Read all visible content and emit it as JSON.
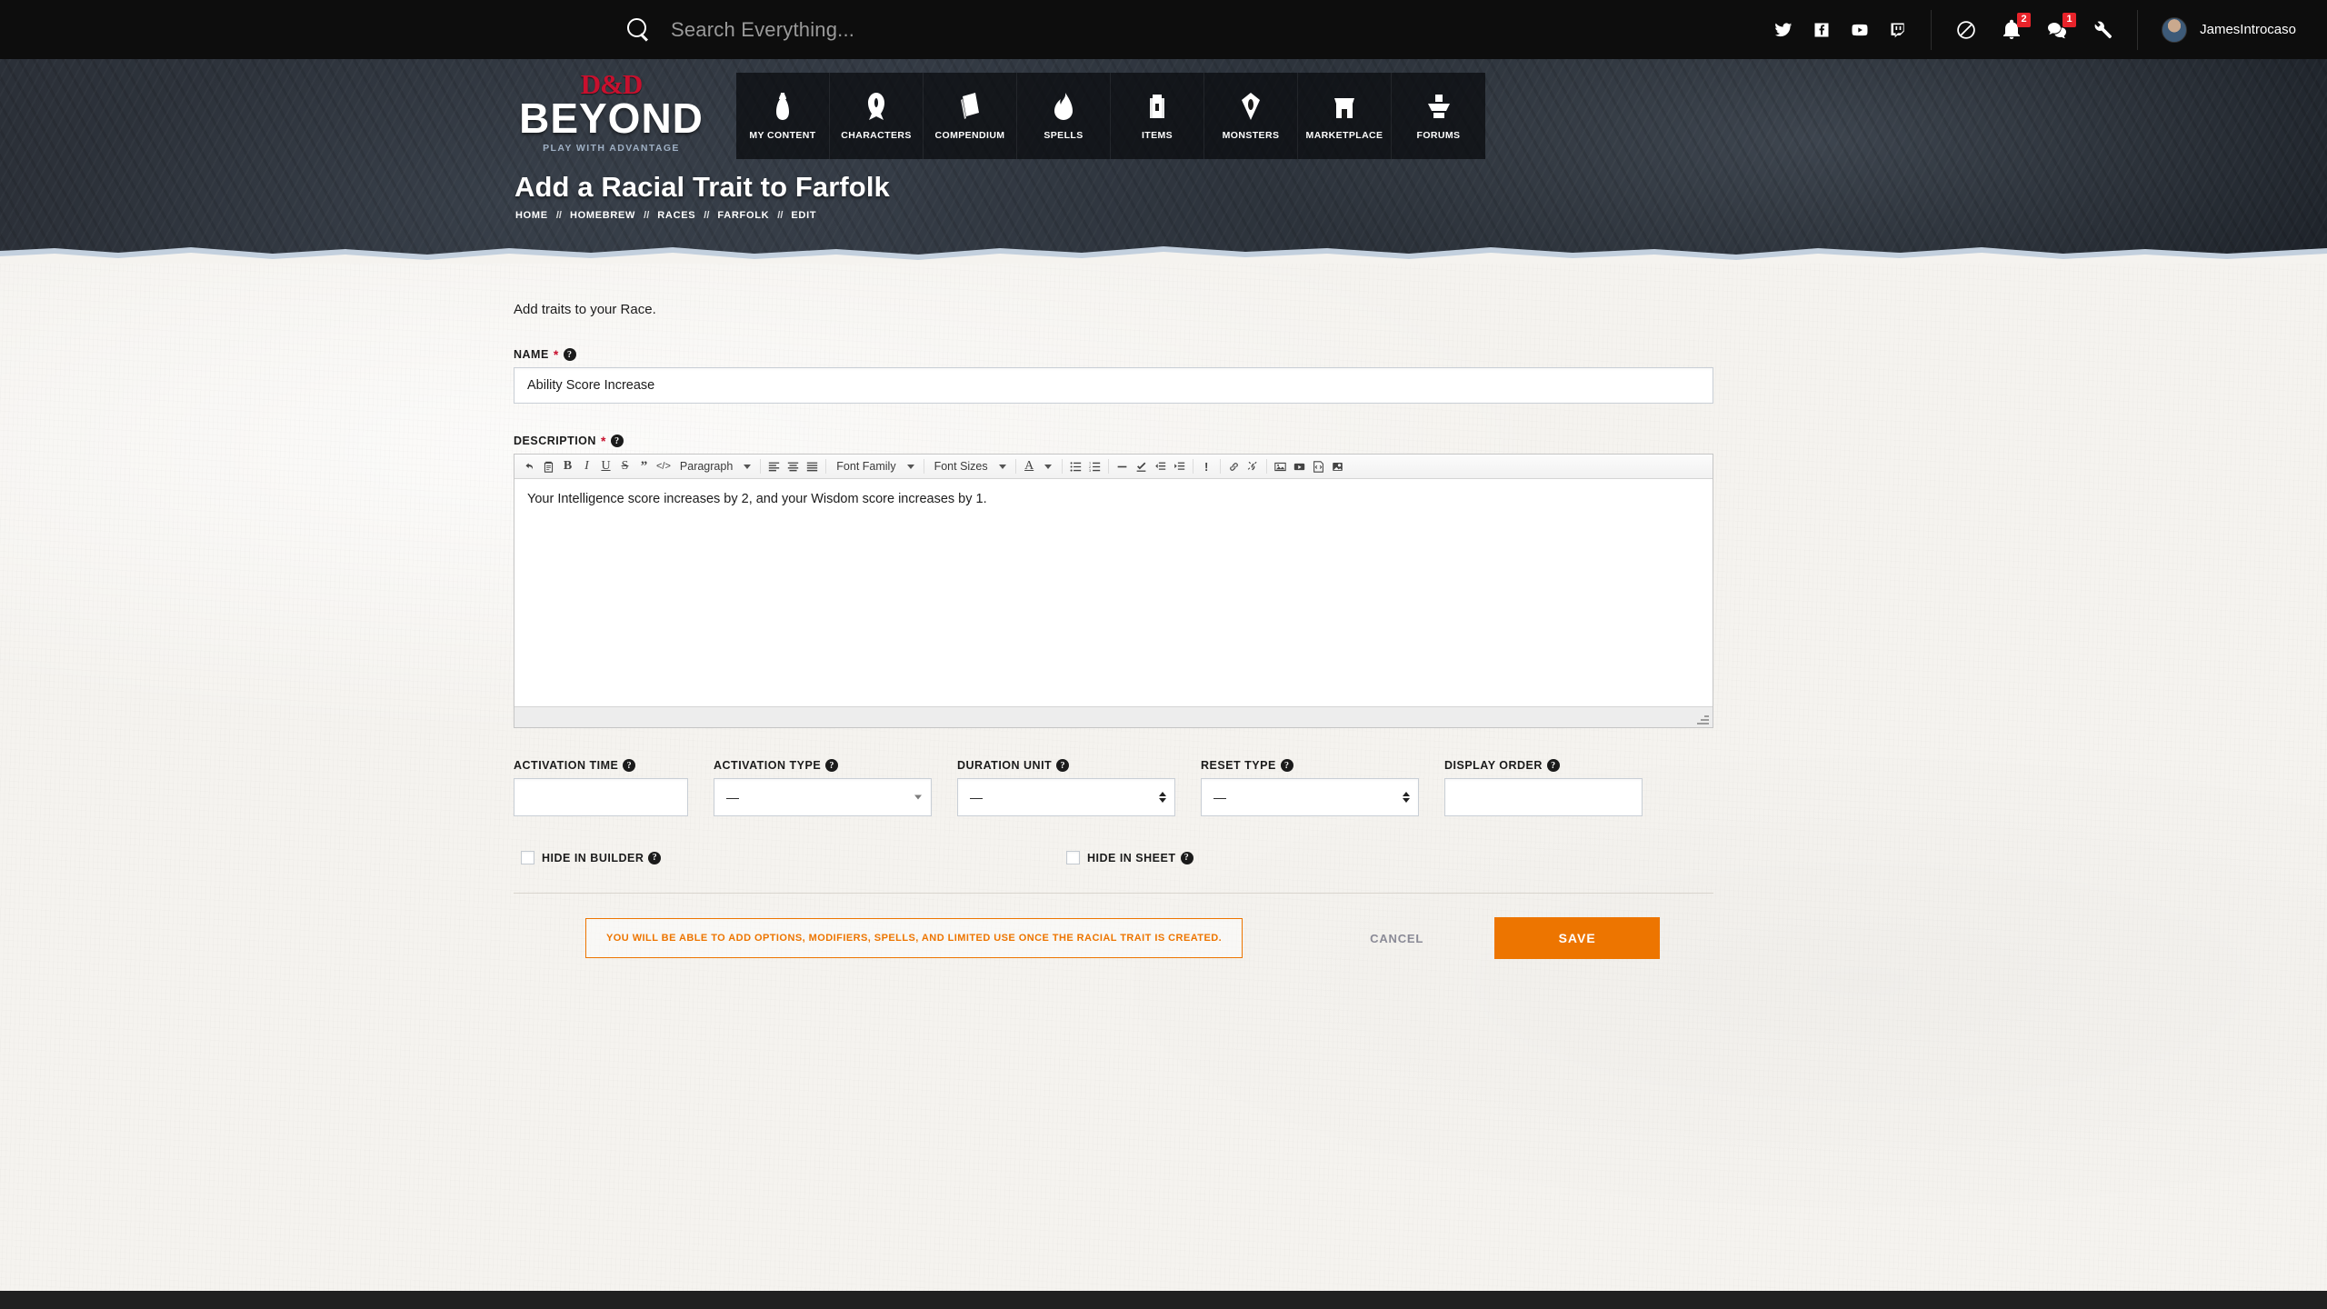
{
  "topbar": {
    "search_placeholder": "Search Everything...",
    "search_icon": "search-icon",
    "social": [
      {
        "name": "twitter-icon",
        "label": "Twitter"
      },
      {
        "name": "facebook-icon",
        "label": "Facebook"
      },
      {
        "name": "youtube-icon",
        "label": "YouTube"
      },
      {
        "name": "twitch-icon",
        "label": "Twitch"
      }
    ],
    "actions": [
      {
        "name": "dice-icon",
        "label": "Dice Roller",
        "badge": ""
      },
      {
        "name": "bell-icon",
        "label": "Notifications",
        "badge": "2"
      },
      {
        "name": "chat-icon",
        "label": "Messages",
        "badge": "1"
      },
      {
        "name": "wrench-icon",
        "label": "Tools",
        "badge": ""
      }
    ],
    "username": "JamesIntrocaso"
  },
  "brand": {
    "dd": "D&D",
    "beyond": "BEYOND",
    "tagline": "PLAY WITH ADVANTAGE"
  },
  "nav": [
    {
      "label": "MY CONTENT",
      "icon": "scroll-bag-icon"
    },
    {
      "label": "CHARACTERS",
      "icon": "helmet-icon"
    },
    {
      "label": "COMPENDIUM",
      "icon": "book-cards-icon"
    },
    {
      "label": "SPELLS",
      "icon": "flame-icon"
    },
    {
      "label": "ITEMS",
      "icon": "backpack-icon"
    },
    {
      "label": "MONSTERS",
      "icon": "eye-icon"
    },
    {
      "label": "MARKETPLACE",
      "icon": "shop-icon"
    },
    {
      "label": "FORUMS",
      "icon": "anvil-icon"
    }
  ],
  "page": {
    "title": "Add a Racial Trait to Farfolk",
    "breadcrumb": [
      "HOME",
      "HOMEBREW",
      "RACES",
      "FARFOLK",
      "EDIT"
    ],
    "breadcrumb_separator": "//",
    "intro": "Add traits to your Race."
  },
  "form": {
    "name": {
      "label": "NAME",
      "required": true,
      "value": "Ability Score Increase"
    },
    "description": {
      "label": "DESCRIPTION",
      "required": true,
      "value": "Your Intelligence score increases by 2, and your Wisdom score increases by 1."
    },
    "editor_toolbar": {
      "block_format": "Paragraph",
      "font_family": "Font Family",
      "font_sizes": "Font Sizes",
      "buttons": [
        "undo-icon",
        "paste-icon",
        "bold-icon",
        "italic-icon",
        "underline-icon",
        "strikethrough-icon",
        "blockquote-icon",
        "source-code-icon",
        "align-left-icon",
        "align-center-icon",
        "align-justify-icon",
        "text-color-icon",
        "bullet-list-icon",
        "numbered-list-icon",
        "horizontal-rule-icon",
        "remove-format-icon",
        "outdent-icon",
        "indent-icon",
        "special-character-icon",
        "link-icon",
        "unlink-icon",
        "image-icon",
        "video-icon",
        "embed-icon",
        "media-icon"
      ]
    },
    "activation_time": {
      "label": "ACTIVATION TIME",
      "value": ""
    },
    "activation_type": {
      "label": "ACTIVATION TYPE",
      "value": "—"
    },
    "duration_unit": {
      "label": "DURATION UNIT",
      "value": "—"
    },
    "reset_type": {
      "label": "RESET TYPE",
      "value": "—"
    },
    "display_order": {
      "label": "DISPLAY ORDER",
      "value": ""
    },
    "hide_in_builder": {
      "label": "HIDE IN BUILDER",
      "checked": false
    },
    "hide_in_sheet": {
      "label": "HIDE IN SHEET",
      "checked": false
    }
  },
  "footer": {
    "notice": "YOU WILL BE ABLE TO ADD OPTIONS, MODIFIERS, SPELLS, AND LIMITED USE ONCE THE RACIAL TRAIT IS CREATED.",
    "cancel_label": "CANCEL",
    "save_label": "SAVE"
  },
  "colors": {
    "accent_orange": "#ED7500",
    "brand_red": "#C8102E",
    "topbar_bg": "#0D0D0D",
    "paper_bg": "#F5F3EF",
    "required_star": "#C8102E"
  },
  "help_glyph": "?"
}
